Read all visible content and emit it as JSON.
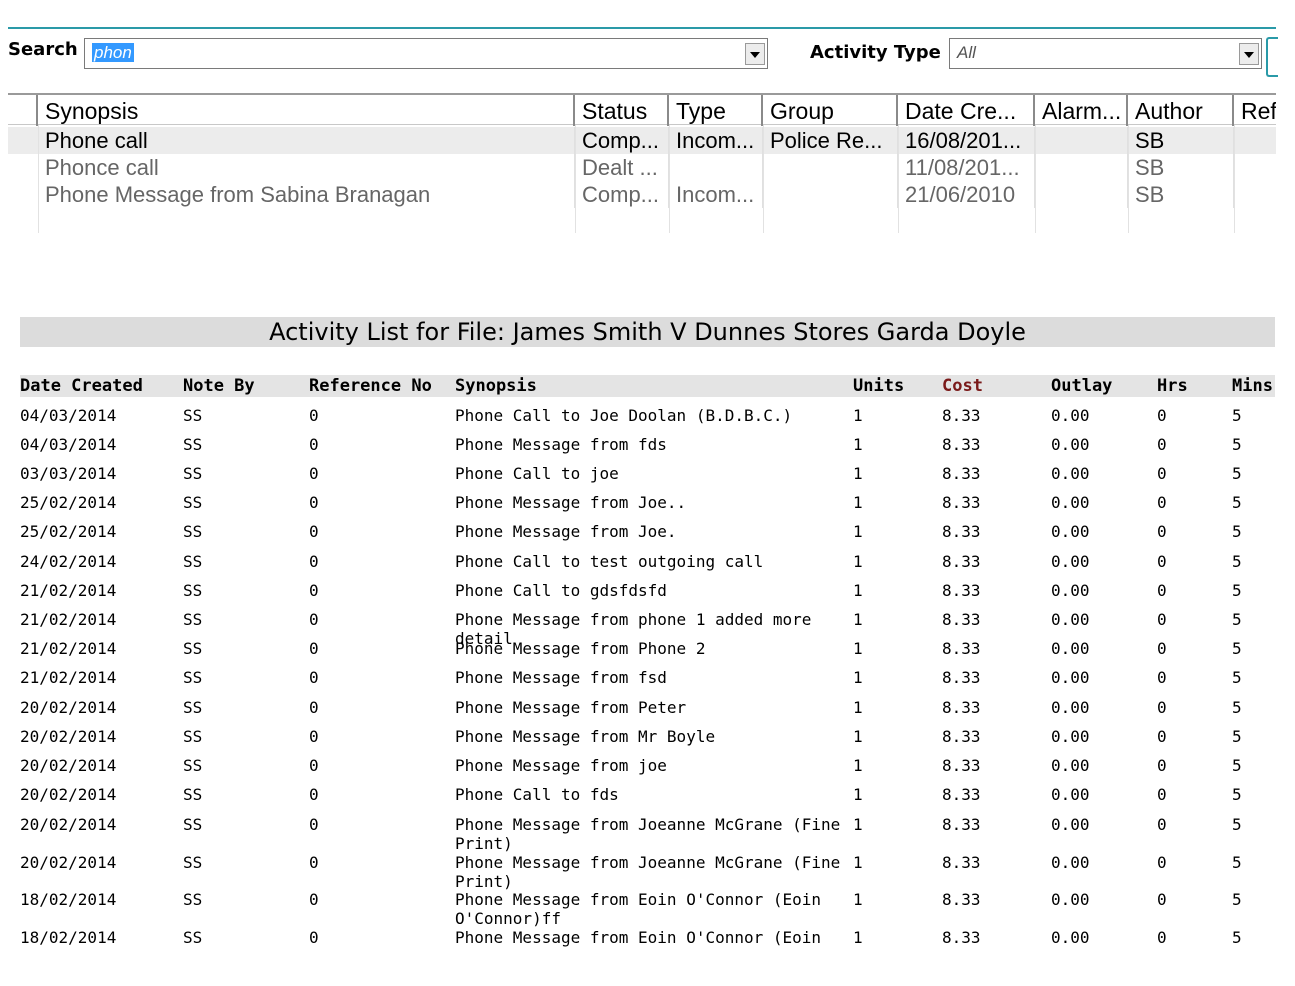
{
  "search": {
    "label": "Search",
    "value": "phon",
    "activity_type_label": "Activity Type",
    "activity_type_value": "All"
  },
  "results_grid": {
    "columns": [
      "Synopsis",
      "Status",
      "Type",
      "Group",
      "Date Cre...",
      "Alarm...",
      "Author",
      "Ref"
    ],
    "rows": [
      [
        "Phone call",
        "Comp...",
        "Incom...",
        "Police Re...",
        "16/08/201...",
        "",
        "SB",
        ""
      ],
      [
        "Phonce call",
        "Dealt ...",
        "",
        "",
        "11/08/201...",
        "",
        "SB",
        ""
      ],
      [
        "Phone Message from Sabina Branagan",
        "Comp...",
        "Incom...",
        "",
        "21/06/2010",
        "",
        "SB",
        ""
      ]
    ]
  },
  "report": {
    "title": "Activity List for File: James Smith V Dunnes Stores Garda Doyle",
    "columns": [
      "Date Created",
      "Note By",
      "Reference No",
      "Synopsis",
      "Units",
      "Cost",
      "Outlay",
      "Hrs",
      "Mins"
    ],
    "rows": [
      [
        "04/03/2014",
        "SS",
        "0",
        "Phone Call to Joe Doolan (B.D.B.C.)",
        "1",
        "8.33",
        "0.00",
        "0",
        "5"
      ],
      [
        "04/03/2014",
        "SS",
        "0",
        "Phone Message from fds",
        "1",
        "8.33",
        "0.00",
        "0",
        "5"
      ],
      [
        "03/03/2014",
        "SS",
        "0",
        "Phone Call to joe",
        "1",
        "8.33",
        "0.00",
        "0",
        "5"
      ],
      [
        "25/02/2014",
        "SS",
        "0",
        "Phone Message from Joe..",
        "1",
        "8.33",
        "0.00",
        "0",
        "5"
      ],
      [
        "25/02/2014",
        "SS",
        "0",
        "Phone Message from Joe.",
        "1",
        "8.33",
        "0.00",
        "0",
        "5"
      ],
      [
        "24/02/2014",
        "SS",
        "0",
        "Phone Call to test outgoing call",
        "1",
        "8.33",
        "0.00",
        "0",
        "5"
      ],
      [
        "21/02/2014",
        "SS",
        "0",
        "Phone Call to gdsfdsfd",
        "1",
        "8.33",
        "0.00",
        "0",
        "5"
      ],
      [
        "21/02/2014",
        "SS",
        "0",
        "Phone Message from phone 1 added more detail",
        "1",
        "8.33",
        "0.00",
        "0",
        "5"
      ],
      [
        "21/02/2014",
        "SS",
        "0",
        "Phone Message from Phone 2",
        "1",
        "8.33",
        "0.00",
        "0",
        "5"
      ],
      [
        "21/02/2014",
        "SS",
        "0",
        "Phone Message from fsd",
        "1",
        "8.33",
        "0.00",
        "0",
        "5"
      ],
      [
        "20/02/2014",
        "SS",
        "0",
        "Phone Message from Peter",
        "1",
        "8.33",
        "0.00",
        "0",
        "5"
      ],
      [
        "20/02/2014",
        "SS",
        "0",
        "Phone Message from Mr Boyle",
        "1",
        "8.33",
        "0.00",
        "0",
        "5"
      ],
      [
        "20/02/2014",
        "SS",
        "0",
        "Phone Message from joe",
        "1",
        "8.33",
        "0.00",
        "0",
        "5"
      ],
      [
        "20/02/2014",
        "SS",
        "0",
        "Phone Call to fds",
        "1",
        "8.33",
        "0.00",
        "0",
        "5"
      ],
      [
        "20/02/2014",
        "SS",
        "0",
        "Phone Message from Joeanne McGrane (Fine Print)",
        "1",
        "8.33",
        "0.00",
        "0",
        "5"
      ],
      [
        "20/02/2014",
        "SS",
        "0",
        "Phone Message from Joeanne McGrane (Fine Print)",
        "1",
        "8.33",
        "0.00",
        "0",
        "5"
      ],
      [
        "18/02/2014",
        "SS",
        "0",
        "Phone Message from Eoin O'Connor (Eoin O'Connor)ff",
        "1",
        "8.33",
        "0.00",
        "0",
        "5"
      ],
      [
        "18/02/2014",
        "SS",
        "0",
        "Phone Message from Eoin O'Connor (Eoin O'Connor)",
        "1",
        "8.33",
        "0.00",
        "0",
        "5"
      ]
    ]
  }
}
